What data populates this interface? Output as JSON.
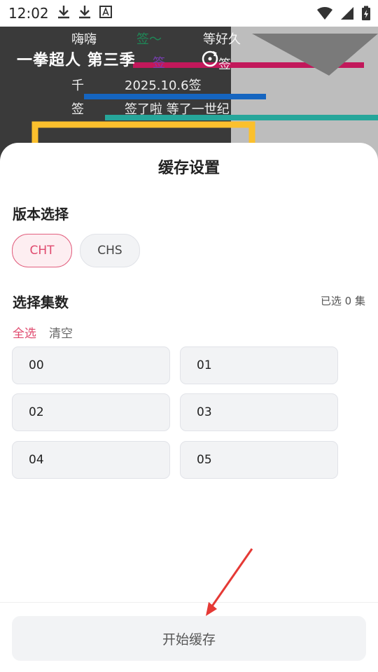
{
  "status_bar": {
    "time": "12:02"
  },
  "video": {
    "title": "一拳超人 第三季",
    "danmaku": [
      "嗨嗨",
      "签～",
      "等好久",
      "签",
      "签",
      "千",
      "2025.10.6签",
      "签",
      "签了啦 等了一世纪"
    ]
  },
  "sheet": {
    "title": "缓存设置",
    "version_label": "版本选择",
    "versions": [
      "CHT",
      "CHS"
    ],
    "selected_version": "CHT",
    "episode_label": "选择集数",
    "selected_count": "已选 0 集",
    "select_all": "全选",
    "clear": "清空",
    "episodes": [
      "00",
      "01",
      "02",
      "03",
      "04",
      "05"
    ],
    "start_button": "开始缓存"
  },
  "colors": {
    "accent": "#e04a6e",
    "chip_bg": "#fdeef1"
  }
}
